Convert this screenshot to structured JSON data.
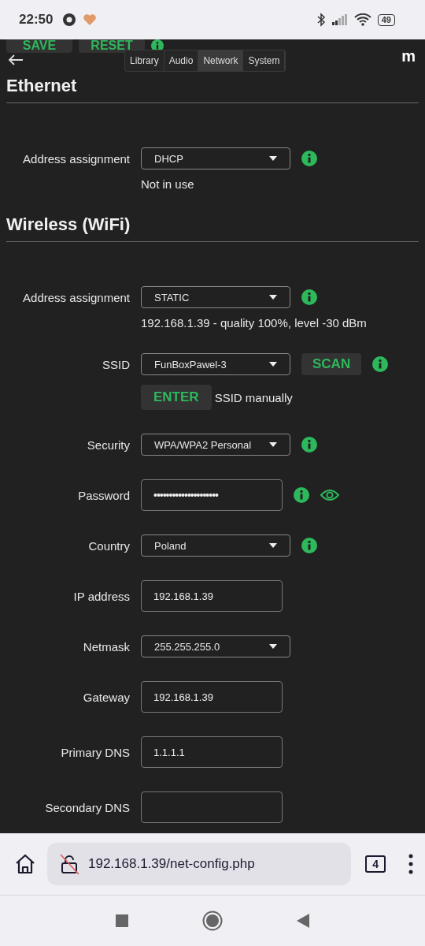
{
  "status_bar": {
    "time": "22:50",
    "battery": "49"
  },
  "header": {
    "buttons": [
      "SAVE",
      "RESET"
    ],
    "tabs": [
      {
        "label": "Library",
        "selected": false
      },
      {
        "label": "Audio",
        "selected": false
      },
      {
        "label": "Network",
        "selected": true
      },
      {
        "label": "System",
        "selected": false
      }
    ],
    "logo": "m"
  },
  "sections": [
    {
      "title": "Ethernet",
      "rows": [
        {
          "kind": "select",
          "label": "Address assignment",
          "value": "DHCP",
          "info": true
        },
        {
          "kind": "note",
          "text": "Not in use"
        }
      ]
    },
    {
      "title": "Wireless (WiFi)",
      "rows": [
        {
          "kind": "select",
          "label": "Address assignment",
          "value": "STATIC",
          "info": true
        },
        {
          "kind": "note",
          "text": "192.168.1.39 - quality 100%, level -30 dBm"
        },
        {
          "kind": "select",
          "label": "SSID",
          "value": "FunBoxPawel-3",
          "button": "SCAN",
          "info": true
        },
        {
          "kind": "manual",
          "button": "ENTER",
          "text": "SSID manually"
        },
        {
          "kind": "select",
          "label": "Security",
          "value": "WPA/WPA2 Personal",
          "info": true
        },
        {
          "kind": "password",
          "label": "Password",
          "value": "•••••••••••••••••••••",
          "info": true,
          "reveal": true
        },
        {
          "kind": "select",
          "label": "Country",
          "value": "Poland",
          "info": true
        },
        {
          "kind": "input",
          "label": "IP address",
          "value": "192.168.1.39"
        },
        {
          "kind": "select",
          "label": "Netmask",
          "value": "255.255.255.0"
        },
        {
          "kind": "input",
          "label": "Gateway",
          "value": "192.168.1.39"
        },
        {
          "kind": "input",
          "label": "Primary DNS",
          "value": "1.1.1.1"
        },
        {
          "kind": "input",
          "label": "Secondary DNS"
        }
      ]
    }
  ],
  "browser": {
    "url": "192.168.1.39/net-config.php",
    "tab_count": "4"
  }
}
